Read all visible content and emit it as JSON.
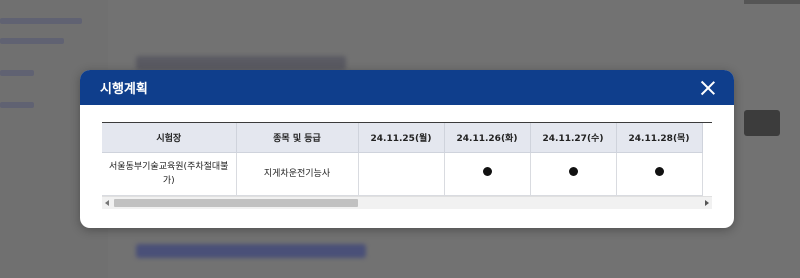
{
  "modal": {
    "title": "시행계획"
  },
  "table": {
    "headers": [
      "시험장",
      "종목 및 등급",
      "24.11.25(월)",
      "24.11.26(화)",
      "24.11.27(수)",
      "24.11.28(목)"
    ],
    "rows": [
      {
        "site": "서울동부기술교육원(주차절대불가)",
        "item": "지게차운전기능사",
        "dates": [
          "",
          "●",
          "●",
          "●"
        ]
      }
    ]
  },
  "colors": {
    "header_bg": "#0f3e8c",
    "table_head_bg": "#e4e7ef"
  }
}
